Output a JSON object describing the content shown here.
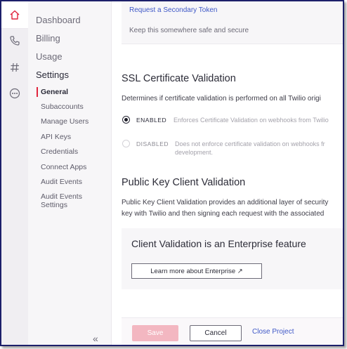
{
  "nav": {
    "items": [
      "Dashboard",
      "Billing",
      "Usage",
      "Settings"
    ],
    "active_item": "Settings",
    "sub_items": [
      "General",
      "Subaccounts",
      "Manage Users",
      "API Keys",
      "Credentials",
      "Connect Apps",
      "Audit Events",
      "Audit Events Settings"
    ],
    "active_sub": "General",
    "collapse_glyph": "«"
  },
  "rail_icons": [
    "home-icon",
    "phone-icon",
    "hash-icon",
    "more-icon"
  ],
  "token": {
    "link": "Request a Secondary Token",
    "note": "Keep this somewhere safe and secure"
  },
  "ssl": {
    "title": "SSL Certificate Validation",
    "description": "Determines if certificate validation is performed on all Twilio origi",
    "enabled_label": "ENABLED",
    "enabled_desc": "Enforces Certificate Validation on webhooks from Twilio",
    "disabled_label": "DISABLED",
    "disabled_desc_1": "Does not enforce certificate validation on webhooks fr",
    "disabled_desc_2": "development.",
    "selected": "ENABLED"
  },
  "pkcv": {
    "title": "Public Key Client Validation",
    "line1": "Public Key Client Validation provides an additional layer of security",
    "line2": "key with Twilio and then signing each request with the associated"
  },
  "enterprise": {
    "title": "Client Validation is an Enterprise feature",
    "button": "Learn more about Enterprise ↗"
  },
  "footer": {
    "save": "Save",
    "cancel": "Cancel",
    "close": "Close Project"
  },
  "colors": {
    "accent": "#e0253d",
    "link": "#3f58c7",
    "save_disabled": "#f3b7c1"
  }
}
